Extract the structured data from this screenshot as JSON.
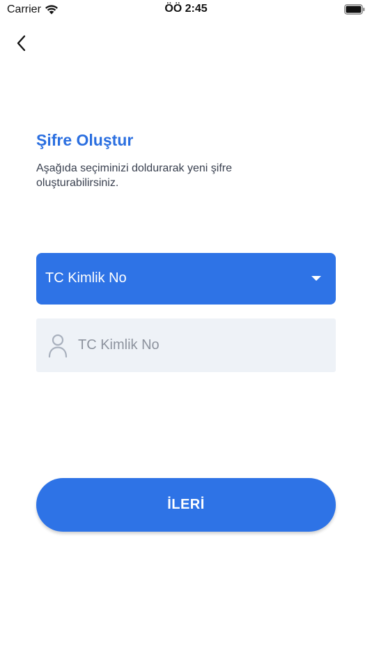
{
  "status_bar": {
    "carrier": "Carrier",
    "time": "ÖÖ 2:45"
  },
  "header": {
    "back_icon": "chevron-left-icon"
  },
  "main": {
    "title": "Şifre Oluştur",
    "subtitle": "Aşağıda seçiminizi doldurarak yeni şifre oluşturabilirsiniz.",
    "id_type_select": {
      "selected": "TC Kimlik No",
      "icon": "caret-down-icon"
    },
    "id_input": {
      "value": "",
      "placeholder": "TC Kimlik No",
      "icon": "user-icon"
    },
    "next_button_label": "İLERİ"
  },
  "colors": {
    "accent": "#2e73e6",
    "title": "#2b6fe0",
    "input_bg": "#eef2f7",
    "text": "#3a4150",
    "placeholder": "#8d939e"
  }
}
